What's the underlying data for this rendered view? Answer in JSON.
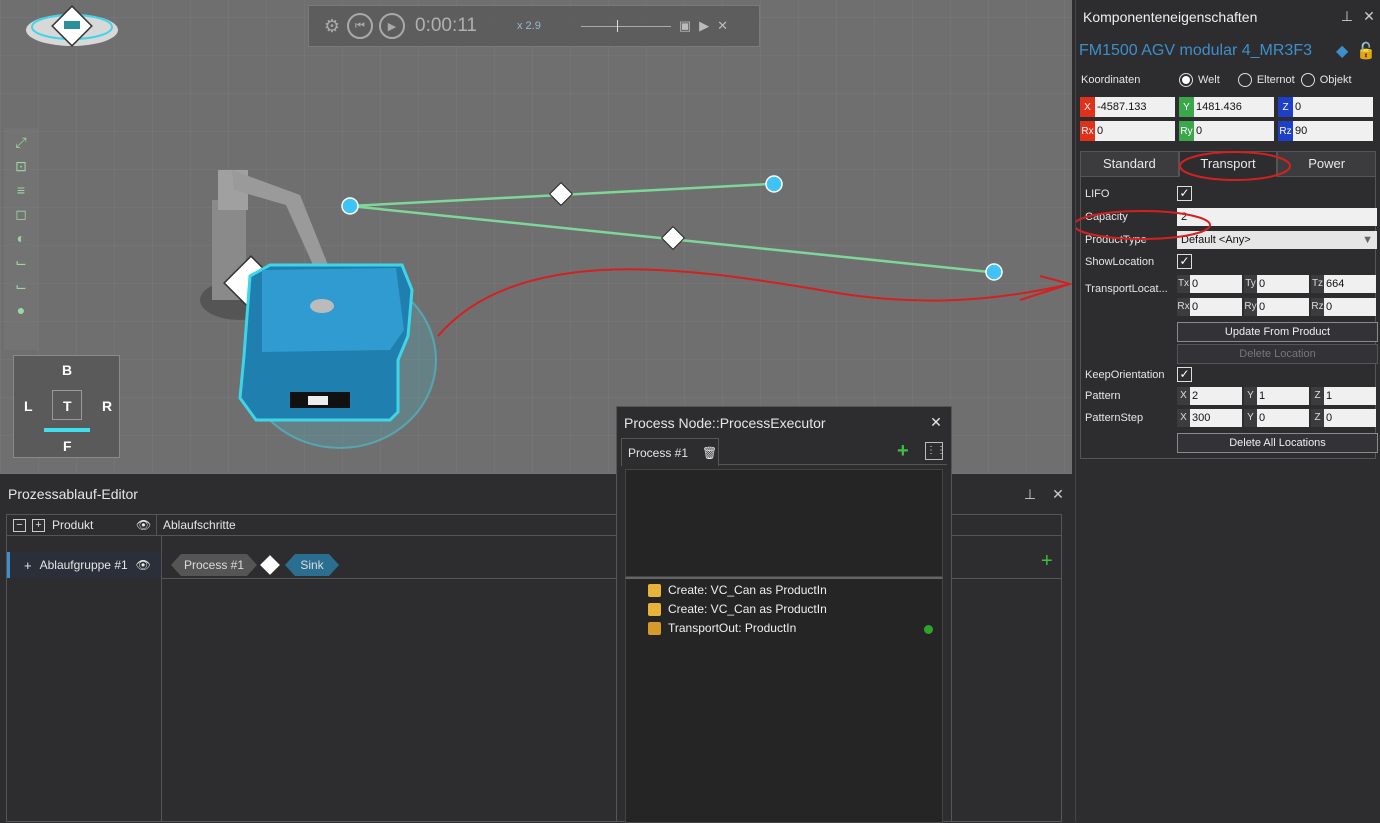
{
  "playbar": {
    "time": "0:00:11",
    "speed": "x 2.9"
  },
  "navcube": {
    "top": "B",
    "left": "L",
    "center": "T",
    "right": "R",
    "bottom": "F"
  },
  "properties": {
    "title": "Komponenteneigenschaften",
    "component_name": "FM1500 AGV modular 4_MR3F3",
    "coords_label": "Koordinaten",
    "radio_options": [
      "Welt",
      "Elternot",
      "Objekt"
    ],
    "radio_selected": "Welt",
    "coords": {
      "X": "-4587.133",
      "Y": "1481.436",
      "Z": "0",
      "Rx": "0",
      "Ry": "0",
      "Rz": "90"
    },
    "tabs": [
      "Standard",
      "Transport",
      "Power"
    ],
    "active_tab": "Transport",
    "transport": {
      "lifo_label": "LIFO",
      "capacity_label": "Capacity",
      "capacity": "2",
      "product_type_label": "ProductType",
      "product_type": "Default <Any>",
      "show_location_label": "ShowLocation",
      "transport_location_label": "TransportLocat...",
      "tx": "0",
      "ty": "0",
      "tz": "664",
      "rx": "0",
      "ry": "0",
      "rz": "0",
      "update_button": "Update From Product",
      "delete_button": "Delete Location",
      "keep_orientation_label": "KeepOrientation",
      "pattern_label": "Pattern",
      "pattern": {
        "X": "2",
        "Y": "1",
        "Z": "1"
      },
      "pattern_step_label": "PatternStep",
      "pattern_step": {
        "X": "300",
        "Y": "0",
        "Z": "0"
      },
      "delete_all_button": "Delete All Locations"
    }
  },
  "flow_editor": {
    "title": "Prozessablauf-Editor",
    "col_product": "Produkt",
    "col_steps": "Ablaufschritte",
    "group": "Ablaufgruppe #1",
    "steps": [
      "Process #1",
      "Sink"
    ]
  },
  "process_node": {
    "title": "Process Node::ProcessExecutor",
    "tab": "Process #1",
    "statements": [
      "Create: VC_Can as ProductIn",
      "Create: VC_Can as ProductIn",
      "TransportOut: ProductIn"
    ]
  },
  "colors": {
    "accent": "#3d8fc9",
    "selection": "#3fd5e8",
    "path": "#7fd69a",
    "annotation": "#d42020"
  }
}
